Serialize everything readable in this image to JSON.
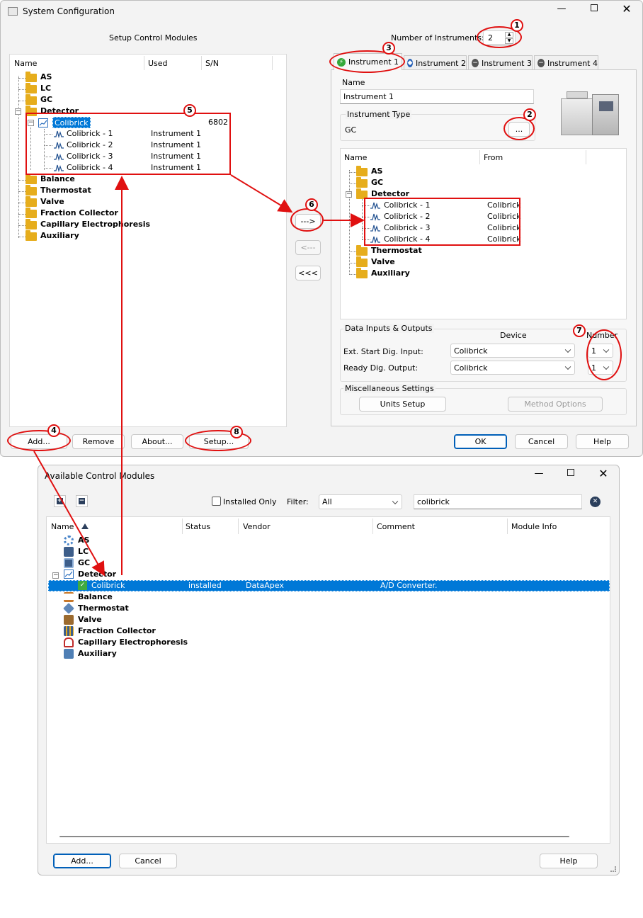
{
  "sys": {
    "title": "System Configuration",
    "setup_label": "Setup Control Modules",
    "num_instruments_label": "Number of Instruments:",
    "num_instruments_value": "2",
    "left_cols": [
      "Name",
      "Used",
      "S/N"
    ],
    "left_tree": [
      {
        "label": "AS"
      },
      {
        "label": "LC"
      },
      {
        "label": "GC"
      },
      {
        "label": "Detector"
      }
    ],
    "colibrick": {
      "label": "Colibrick",
      "sn": "6802"
    },
    "children": [
      {
        "name": "Colibrick - 1",
        "used": "Instrument 1"
      },
      {
        "name": "Colibrick - 2",
        "used": "Instrument 1"
      },
      {
        "name": "Colibrick - 3",
        "used": "Instrument 1"
      },
      {
        "name": "Colibrick - 4",
        "used": "Instrument 1"
      }
    ],
    "left_tree_after": [
      "Balance",
      "Thermostat",
      "Valve",
      "Fraction Collector",
      "Capillary Electrophoresis",
      "Auxiliary"
    ],
    "tabs": [
      "Instrument 1",
      "Instrument 2",
      "Instrument 3",
      "Instrument 4"
    ],
    "name_label": "Name",
    "name_value": "Instrument 1",
    "type_label": "Instrument Type",
    "type_value": "GC",
    "browse": "...",
    "right_cols": [
      "Name",
      "From"
    ],
    "right_tree_top": [
      "AS",
      "GC",
      "Detector"
    ],
    "right_children": [
      {
        "name": "Colibrick - 1",
        "from": "Colibrick"
      },
      {
        "name": "Colibrick - 2",
        "from": "Colibrick"
      },
      {
        "name": "Colibrick - 3",
        "from": "Colibrick"
      },
      {
        "name": "Colibrick - 4",
        "from": "Colibrick"
      }
    ],
    "right_tree_after": [
      "Thermostat",
      "Valve",
      "Auxiliary"
    ],
    "arrow_add": "--->",
    "arrow_remove": "<---",
    "arrow_remove_all": "<<<",
    "dio_title": "Data Inputs & Outputs",
    "device_label": "Device",
    "number_label": "Number",
    "ext_start_label": "Ext. Start Dig. Input:",
    "ext_start_device": "Colibrick",
    "ext_start_number": "1",
    "ready_label": "Ready Dig. Output:",
    "ready_device": "Colibrick",
    "ready_number": "1",
    "misc_title": "Miscellaneous Settings",
    "units_setup": "Units Setup",
    "method_options": "Method Options",
    "add": "Add...",
    "remove": "Remove",
    "about": "About...",
    "setup": "Setup...",
    "ok": "OK",
    "cancel": "Cancel",
    "help": "Help"
  },
  "acm": {
    "title": "Available Control Modules",
    "installed_only": "Installed Only",
    "filter_label": "Filter:",
    "filter_value": "All",
    "search_value": "colibrick",
    "cols": [
      "Name",
      "Status",
      "Vendor",
      "Comment",
      "Module Info"
    ],
    "tree": [
      "AS",
      "LC",
      "GC",
      "Detector"
    ],
    "selected": {
      "name": "Colibrick",
      "status": "installed",
      "vendor": "DataApex",
      "comment": "A/D Converter."
    },
    "tree_after": [
      "Balance",
      "Thermostat",
      "Valve",
      "Fraction Collector",
      "Capillary Electrophoresis",
      "Auxiliary"
    ],
    "add": "Add...",
    "cancel": "Cancel",
    "help": "Help"
  },
  "annotations": [
    "1",
    "2",
    "3",
    "4",
    "5",
    "6",
    "7",
    "8"
  ],
  "colors": {
    "annotation": "#e01010",
    "selection": "#0078d7",
    "folder": "#e6ad1c"
  }
}
